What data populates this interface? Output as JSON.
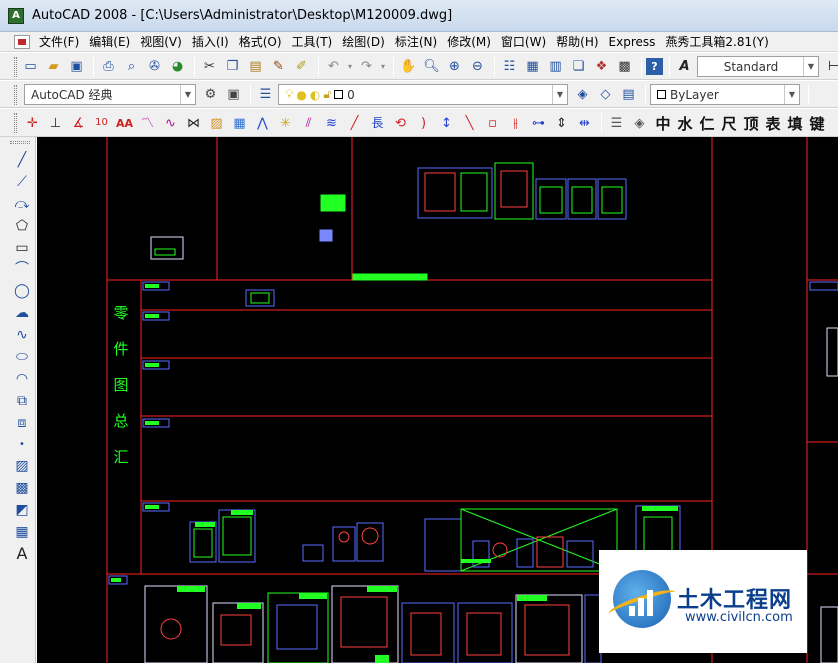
{
  "window": {
    "title": "AutoCAD 2008 - [C:\\Users\\Administrator\\Desktop\\M120009.dwg]",
    "app_icon": "autocad-app-icon"
  },
  "menu": {
    "items": [
      "文件(F)",
      "编辑(E)",
      "视图(V)",
      "插入(I)",
      "格式(O)",
      "工具(T)",
      "绘图(D)",
      "标注(N)",
      "修改(M)",
      "窗口(W)",
      "帮助(H)",
      "Express",
      "燕秀工具箱2.81(Y)"
    ]
  },
  "toolbar_standard": {
    "text_style": "Standard"
  },
  "toolbar_layers": {
    "workspace": "AutoCAD 经典",
    "layer_name": "0",
    "color_control": "ByLayer"
  },
  "toolbar_yanxiu": {
    "text_tools": [
      "中",
      "水",
      "仁",
      "尺",
      "顶",
      "表",
      "填",
      "键"
    ]
  },
  "drawing": {
    "vertical_label": [
      "零",
      "件",
      "图",
      "总",
      "汇"
    ],
    "colors": {
      "frame_red": "#ff2222",
      "block_green": "#22ff22",
      "block_blue": "#5a6cff",
      "background": "#000000"
    }
  },
  "watermark": {
    "name": "土木工程网",
    "url": "www.civilcn.com"
  }
}
